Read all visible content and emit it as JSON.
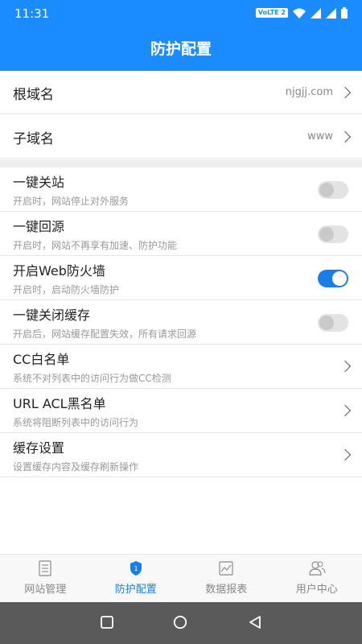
{
  "status_bar": {
    "time": "11:31",
    "volte": "VoLTE 2"
  },
  "header": {
    "title": "防护配置"
  },
  "domain": {
    "root": {
      "label": "根域名",
      "value": "njgjj.com"
    },
    "sub": {
      "label": "子域名",
      "value": "www"
    }
  },
  "settings": [
    {
      "title": "一键关站",
      "desc": "开启时，网站停止对外服务",
      "control": "toggle",
      "on": false
    },
    {
      "title": "一键回源",
      "desc": "开启时，网站不再享有加速、防护功能",
      "control": "toggle",
      "on": false
    },
    {
      "title": "开启Web防火墙",
      "desc": "开启时，启动防火墙防护",
      "control": "toggle",
      "on": true
    },
    {
      "title": "一键关闭缓存",
      "desc": "开启后，网站缓存配置失效，所有请求回源",
      "control": "toggle",
      "on": false
    },
    {
      "title": "CC白名单",
      "desc": "系统不对列表中的访问行为做CC检测",
      "control": "chevron"
    },
    {
      "title": "URL ACL黑名单",
      "desc": "系统将阻断列表中的访问行为",
      "control": "chevron"
    },
    {
      "title": "缓存设置",
      "desc": "设置缓存内容及缓存刷新操作",
      "control": "chevron"
    }
  ],
  "tabs": [
    {
      "label": "网站管理",
      "icon": "document-icon",
      "active": false
    },
    {
      "label": "防护配置",
      "icon": "shield-icon",
      "active": true
    },
    {
      "label": "数据报表",
      "icon": "chart-icon",
      "active": false
    },
    {
      "label": "用户中心",
      "icon": "users-icon",
      "active": false
    }
  ],
  "colors": {
    "primary": "#1a8cff",
    "toggle_on": "#1a7ee8",
    "system_nav": "#5a5a5a"
  }
}
